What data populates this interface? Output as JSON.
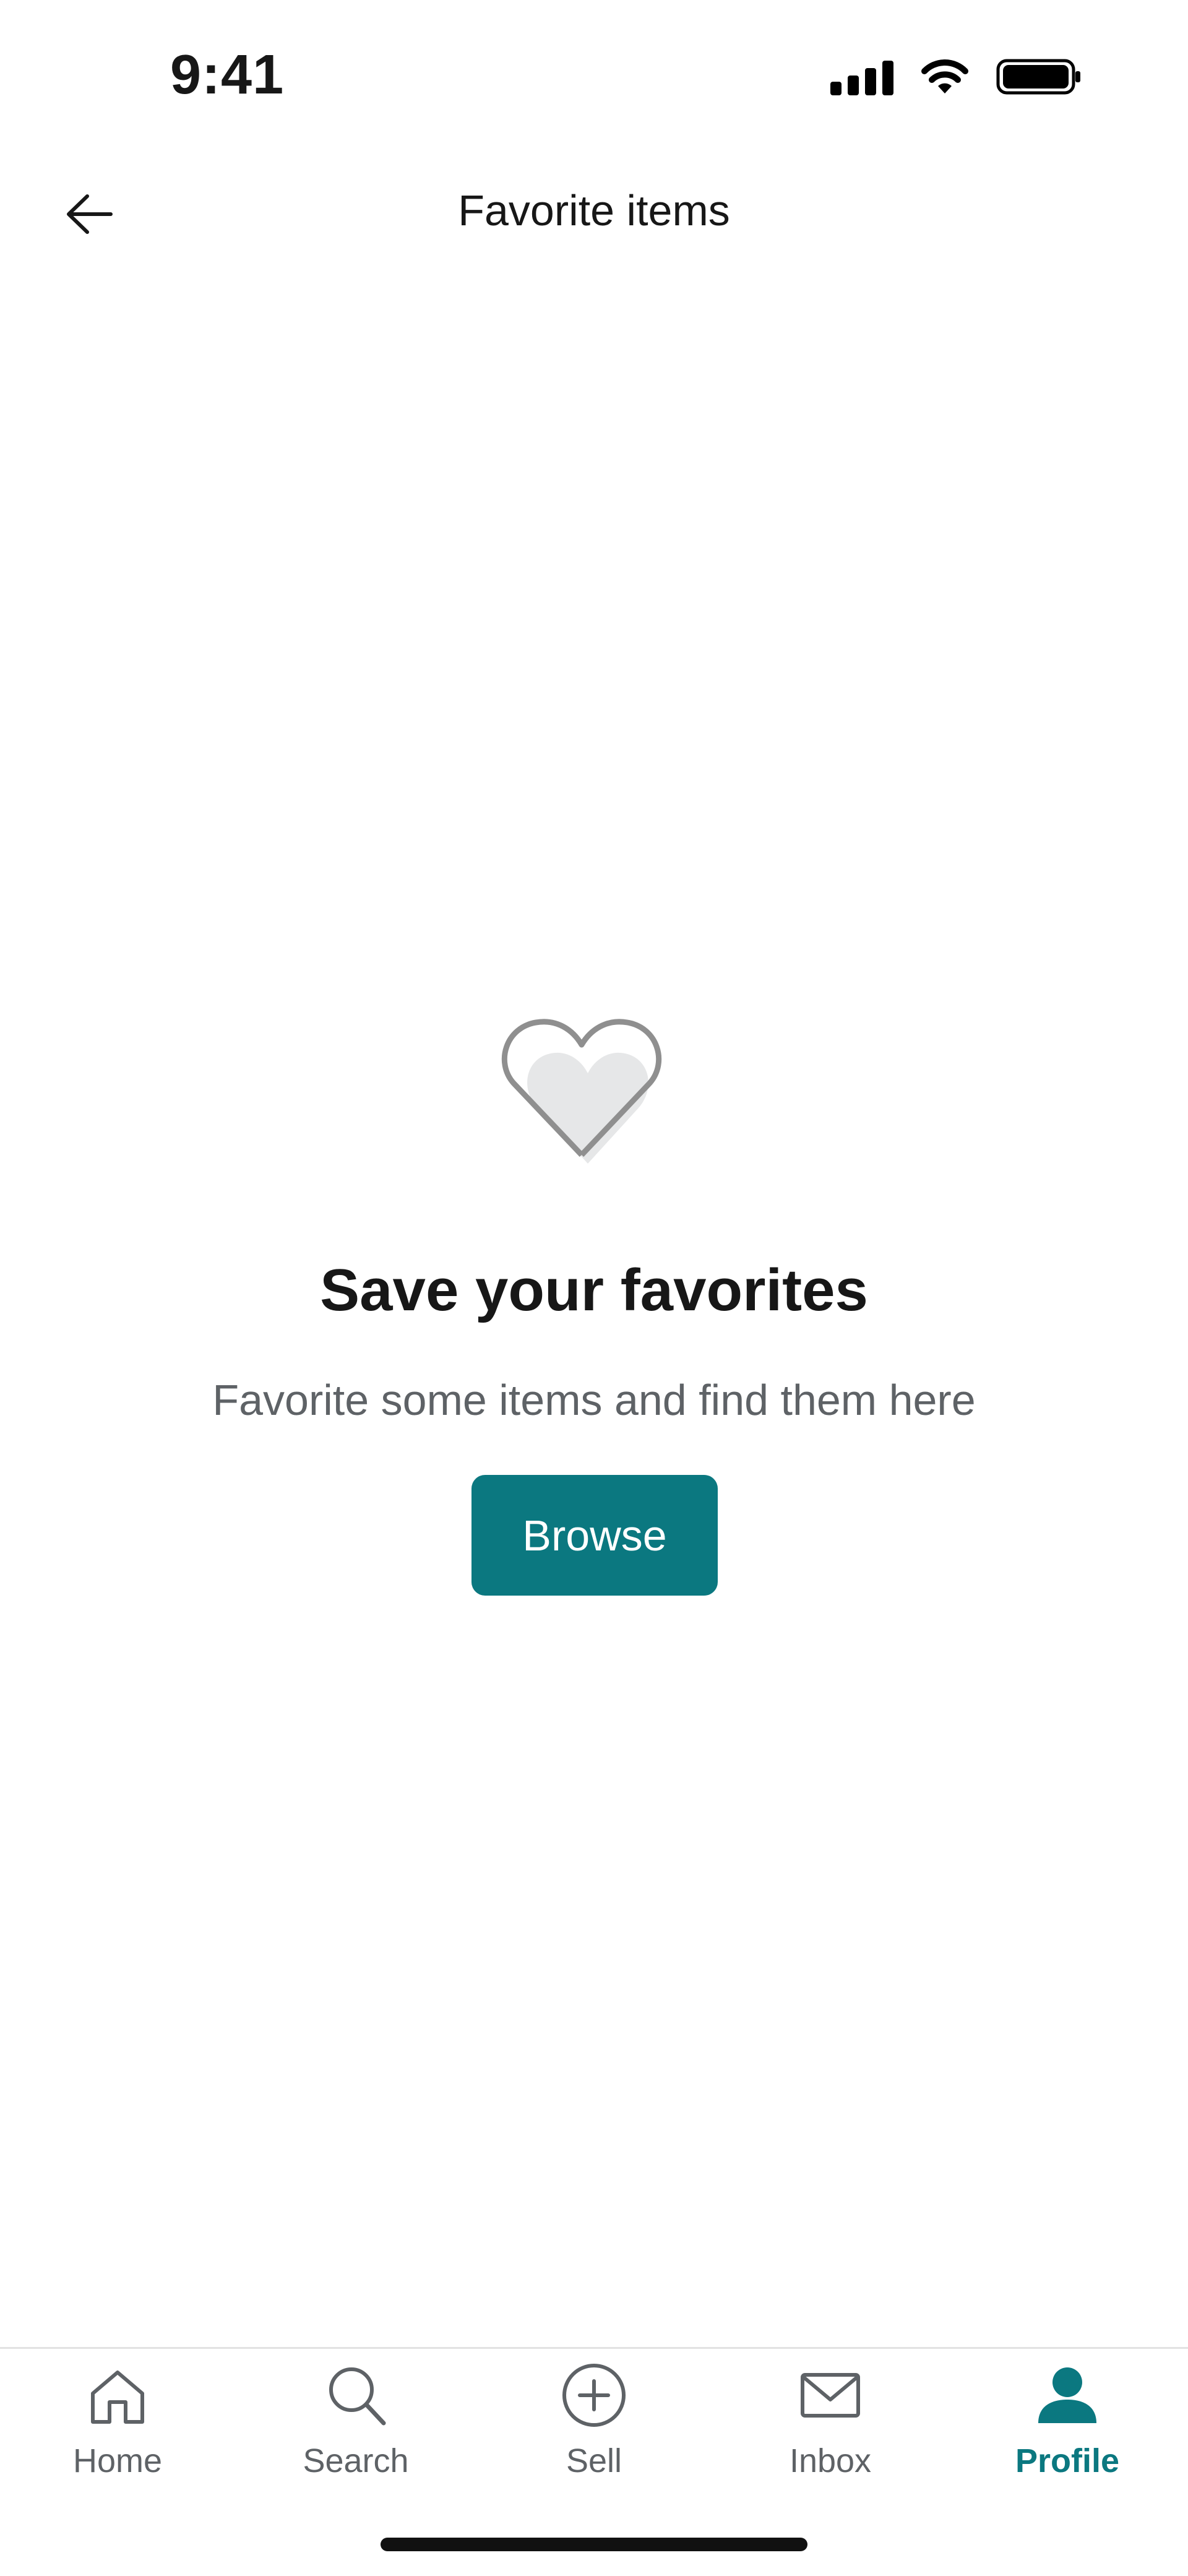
{
  "status_bar": {
    "time": "9:41"
  },
  "header": {
    "title": "Favorite items"
  },
  "empty_state": {
    "title": "Save your favorites",
    "subtitle": "Favorite some items and find them here",
    "button_label": "Browse"
  },
  "bottom_nav": {
    "items": [
      {
        "label": "Home",
        "icon": "home-icon",
        "active": false
      },
      {
        "label": "Search",
        "icon": "search-icon",
        "active": false
      },
      {
        "label": "Sell",
        "icon": "plus-circle-icon",
        "active": false
      },
      {
        "label": "Inbox",
        "icon": "mail-icon",
        "active": false
      },
      {
        "label": "Profile",
        "icon": "person-icon",
        "active": true
      }
    ]
  },
  "colors": {
    "accent": "#0b7880",
    "text": "#171717",
    "muted": "#5e6266",
    "icon_gray": "#8f8f8f",
    "icon_fill": "#e6e7e8"
  }
}
